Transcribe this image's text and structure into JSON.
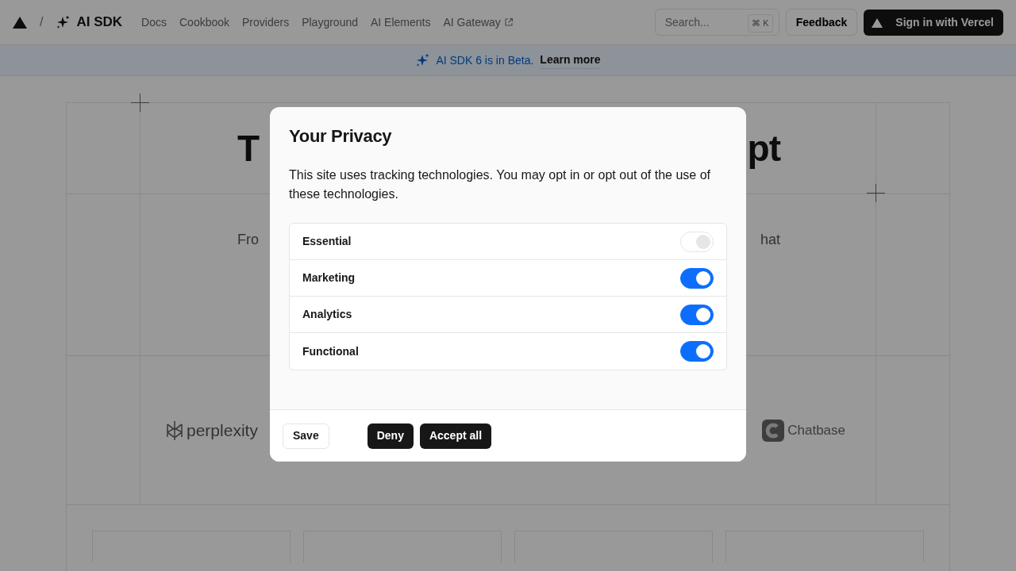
{
  "nav": {
    "divider": "/",
    "brand": "AI SDK",
    "links": [
      {
        "label": "Docs",
        "external": false
      },
      {
        "label": "Cookbook",
        "external": false
      },
      {
        "label": "Providers",
        "external": false
      },
      {
        "label": "Playground",
        "external": false
      },
      {
        "label": "AI Elements",
        "external": false
      },
      {
        "label": "AI Gateway",
        "external": true
      }
    ],
    "search": {
      "placeholder": "Search...",
      "shortcut": "⌘ K"
    },
    "feedback_button": "Feedback",
    "signin_button": "Sign in with Vercel"
  },
  "banner": {
    "text": "AI SDK 6 is in Beta.",
    "link": "Learn more"
  },
  "hero": {
    "heading_left": "T",
    "heading_right": "pt",
    "subtitle_left": "Fro",
    "subtitle_right": "hat"
  },
  "logos": [
    {
      "name": "perplexity",
      "kind": "perplexity"
    },
    {
      "name": "Chatbase",
      "kind": "chatbase"
    }
  ],
  "dialog": {
    "title": "Your Privacy",
    "description": "This site uses tracking technologies. You may opt in or opt out of the use of these technologies.",
    "categories": [
      {
        "label": "Essential",
        "on": true,
        "disabled": true
      },
      {
        "label": "Marketing",
        "on": true,
        "disabled": false
      },
      {
        "label": "Analytics",
        "on": true,
        "disabled": false
      },
      {
        "label": "Functional",
        "on": true,
        "disabled": false
      }
    ],
    "buttons": [
      {
        "label": "Save",
        "kind": "outline"
      },
      {
        "label": "Deny",
        "kind": "dark"
      },
      {
        "label": "Accept all",
        "kind": "dark"
      }
    ]
  }
}
